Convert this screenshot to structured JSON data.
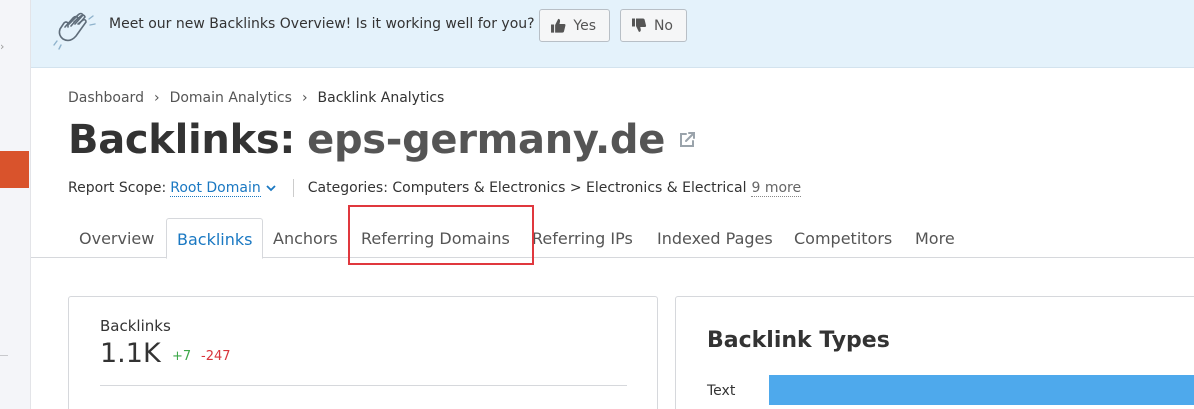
{
  "banner": {
    "message": "Meet our new Backlinks Overview! Is it working well for you?",
    "yes_label": "Yes",
    "no_label": "No"
  },
  "breadcrumb": {
    "items": [
      "Dashboard",
      "Domain Analytics",
      "Backlink Analytics"
    ]
  },
  "header": {
    "title_prefix": "Backlinks:",
    "domain": "eps-germany.de"
  },
  "scope": {
    "label": "Report Scope:",
    "value": "Root Domain",
    "categories_text": "Categories: Computers & Electronics > Electronics & Electrical",
    "more_link": "9 more"
  },
  "tabs": [
    {
      "label": "Overview",
      "active": false
    },
    {
      "label": "Backlinks",
      "active": true
    },
    {
      "label": "Anchors",
      "active": false
    },
    {
      "label": "Referring Domains",
      "active": false,
      "highlighted": true
    },
    {
      "label": "Referring IPs",
      "active": false
    },
    {
      "label": "Indexed Pages",
      "active": false
    },
    {
      "label": "Competitors",
      "active": false
    },
    {
      "label": "More",
      "active": false
    }
  ],
  "metrics": {
    "backlinks_label": "Backlinks",
    "backlinks_value": "1.1K",
    "delta_up": "+7",
    "delta_down": "-247"
  },
  "backlink_types": {
    "title": "Backlink Types",
    "rows": [
      {
        "label": "Text"
      }
    ]
  },
  "colors": {
    "accent": "#1a78c2",
    "banner_bg": "#e4f2fb",
    "highlight": "#e0383e",
    "positive": "#3ea84a",
    "negative": "#d9343b",
    "bar": "#4ea9ec",
    "rail_active": "#d9532c"
  }
}
